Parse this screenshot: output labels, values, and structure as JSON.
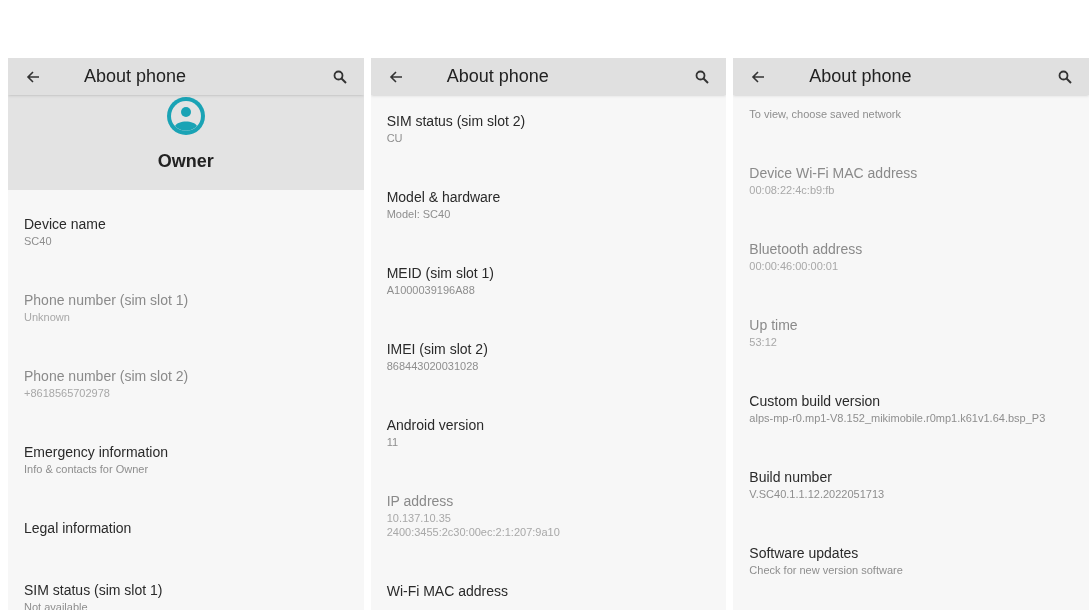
{
  "panels": [
    {
      "title": "About phone",
      "profile": {
        "name": "Owner"
      },
      "items": [
        {
          "title": "Device name",
          "subtitle": [
            "SC40"
          ],
          "disabled": false
        },
        {
          "title": "Phone number (sim slot 1)",
          "subtitle": [
            "Unknown"
          ],
          "disabled": true
        },
        {
          "title": "Phone number (sim slot 2)",
          "subtitle": [
            "+8618565702978"
          ],
          "disabled": true
        },
        {
          "title": "Emergency information",
          "subtitle": [
            "Info & contacts for Owner"
          ],
          "disabled": false
        },
        {
          "title": "Legal information",
          "disabled": false
        },
        {
          "title": "SIM status (sim slot 1)",
          "subtitle": [
            "Not available"
          ],
          "disabled": false
        }
      ]
    },
    {
      "title": "About phone",
      "items": [
        {
          "title": "SIM status (sim slot 2)",
          "subtitle": [
            "CU"
          ],
          "disabled": false
        },
        {
          "title": "Model & hardware",
          "subtitle": [
            "Model: SC40"
          ],
          "disabled": false
        },
        {
          "title": "MEID (sim slot 1)",
          "subtitle": [
            "A1000039196A88"
          ],
          "disabled": false
        },
        {
          "title": "IMEI (sim slot 2)",
          "subtitle": [
            "868443020031028"
          ],
          "disabled": false
        },
        {
          "title": "Android version",
          "subtitle": [
            "11"
          ],
          "disabled": false
        },
        {
          "title": "IP address",
          "subtitle": [
            "10.137.10.35",
            "2400:3455:2c30:00ec:2:1:207:9a10"
          ],
          "disabled": true
        },
        {
          "title": "Wi-Fi MAC address",
          "disabled": false
        }
      ]
    },
    {
      "title": "About phone",
      "items": [
        {
          "subtitle": [
            "To view, choose saved network"
          ],
          "disabled": false
        },
        {
          "title": "Device Wi-Fi MAC address",
          "subtitle": [
            "00:08:22:4c:b9:fb"
          ],
          "disabled": true
        },
        {
          "title": "Bluetooth address",
          "subtitle": [
            "00:00:46:00:00:01"
          ],
          "disabled": true
        },
        {
          "title": "Up time",
          "subtitle": [
            "53:12"
          ],
          "disabled": true
        },
        {
          "title": "Custom build version",
          "subtitle": [
            "alps-mp-r0.mp1-V8.152_mikimobile.r0mp1.k61v1.64.bsp_P3"
          ],
          "disabled": false
        },
        {
          "title": "Build number",
          "subtitle": [
            "V.SC40.1.1.12.2022051713"
          ],
          "disabled": false
        },
        {
          "title": "Software updates",
          "subtitle": [
            "Check for new version software"
          ],
          "disabled": false
        }
      ]
    }
  ]
}
